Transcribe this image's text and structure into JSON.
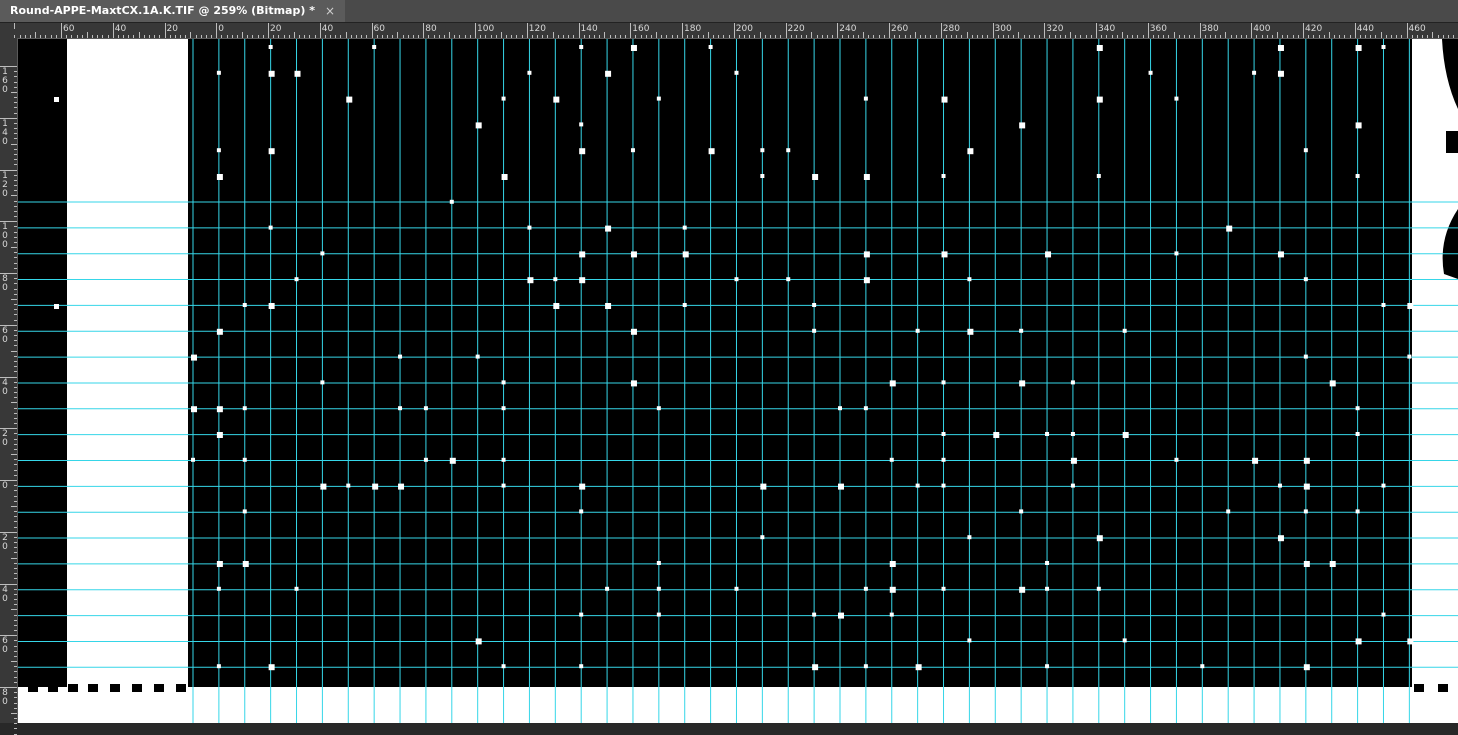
{
  "window": {
    "tab_title": "Round-APPE-MaxtCX.1A.K.TIF @ 259% (Bitmap) *",
    "close_glyph": "×"
  },
  "colors": {
    "guide": "#36d6e8",
    "ink": "#000000",
    "paper": "#ffffff",
    "ruler_bg": "#383838"
  },
  "rulers": {
    "horizontal_labels": [
      "60",
      "40",
      "20",
      "0",
      "20",
      "40",
      "60",
      "80",
      "100",
      "120",
      "140",
      "160",
      "180",
      "200",
      "220",
      "240",
      "260",
      "280",
      "300",
      "320",
      "340",
      "360",
      "380",
      "400",
      "420",
      "440",
      "460"
    ],
    "vertical_labels": [
      "160",
      "140",
      "120",
      "100",
      "80",
      "60",
      "40",
      "20",
      "0",
      "20",
      "40",
      "60",
      "80"
    ]
  }
}
